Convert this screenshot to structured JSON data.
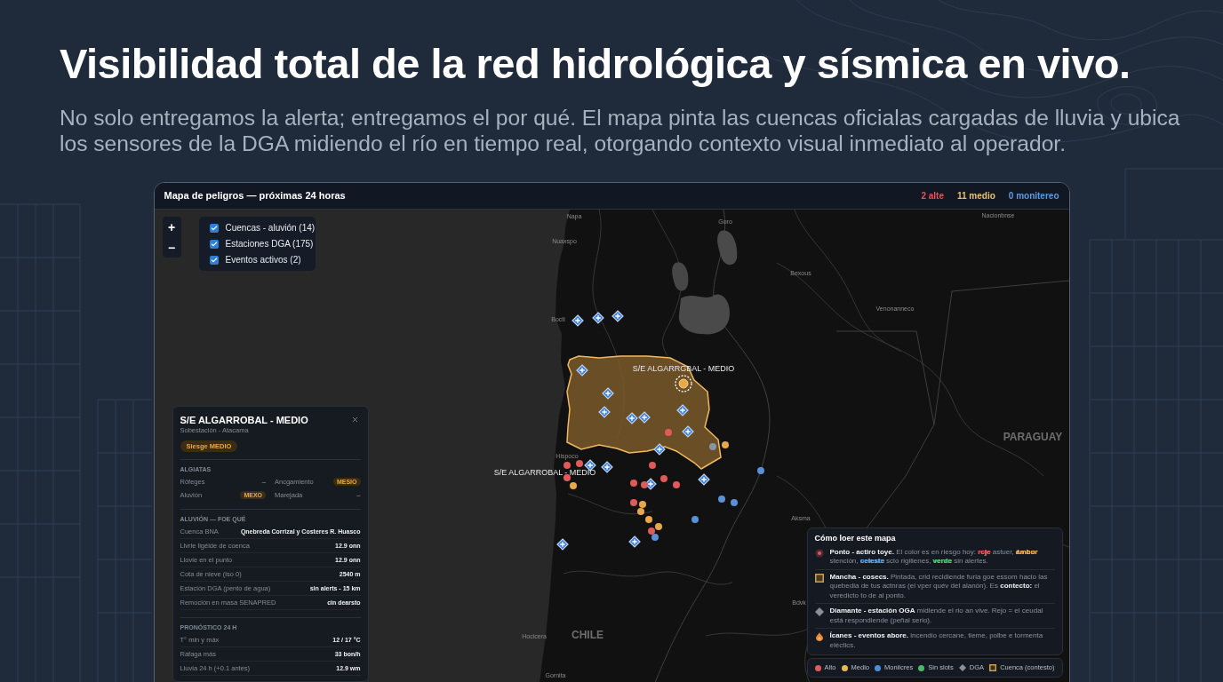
{
  "headline": "Visibilidad total de la red hidrológica y sísmica en vivo.",
  "intro": "No solo entregamos la alerta; entregamos el por qué. El mapa pinta las cuencas oficialas cargadas de lluvia y ubica los sensores de la DGA midiendo el río en tiempo real, otorgando contexto visual inmediato al operador.",
  "map_card": {
    "title": "Mapa de peligros — próximas 24 horas",
    "counts": [
      {
        "text": "2 alte",
        "color": "#e5535b"
      },
      {
        "text": "11 medio",
        "color": "#e8c070"
      },
      {
        "text": "0 monitereo",
        "color": "#5b9be0"
      }
    ],
    "zoom_buttons": [
      "+",
      "−"
    ],
    "layers": [
      {
        "label": "Cuencas - aluvión (14)",
        "checked": true
      },
      {
        "label": "Estaciones DGA (175)",
        "checked": true
      },
      {
        "label": "Eventos activos (2)",
        "checked": true
      }
    ],
    "places": [
      {
        "name": "Napa",
        "kind": "town"
      },
      {
        "name": "Nuaxspo",
        "kind": "town"
      },
      {
        "name": "Goro",
        "kind": "town"
      },
      {
        "name": "Bexous",
        "kind": "town"
      },
      {
        "name": "Nacionbnse",
        "kind": "town"
      },
      {
        "name": "Venonanneco",
        "kind": "town"
      },
      {
        "name": "Bocti",
        "kind": "town"
      },
      {
        "name": "S/E ALGARRGBAL - MEDIO",
        "kind": "marker"
      },
      {
        "name": "Hispoco",
        "kind": "town"
      },
      {
        "name": "S/E ALGARROBAL - MEDIO",
        "kind": "marker"
      },
      {
        "name": "PARAGUAY",
        "kind": "country"
      },
      {
        "name": "Aksma",
        "kind": "town"
      },
      {
        "name": "Bdvk",
        "kind": "town"
      },
      {
        "name": "Hocicera",
        "kind": "town"
      },
      {
        "name": "CHILE",
        "kind": "country"
      },
      {
        "name": "Gornita",
        "kind": "town"
      }
    ],
    "markers": [
      {
        "kind": "station",
        "selected": false
      },
      {
        "kind": "station",
        "selected": false
      },
      {
        "kind": "station",
        "selected": false
      },
      {
        "kind": "station",
        "selected": false
      },
      {
        "kind": "station",
        "selected": false
      },
      {
        "kind": "station",
        "selected": false
      },
      {
        "kind": "station",
        "selected": false
      },
      {
        "kind": "station",
        "selected": false
      },
      {
        "kind": "station",
        "selected": false
      },
      {
        "kind": "station",
        "selected": false
      },
      {
        "kind": "station",
        "selected": false
      },
      {
        "kind": "station",
        "selected": false
      },
      {
        "kind": "station",
        "selected": false
      },
      {
        "kind": "station",
        "selected": false
      },
      {
        "kind": "station",
        "selected": false
      },
      {
        "kind": "station",
        "selected": false
      },
      {
        "kind": "station",
        "selected": false
      },
      {
        "kind": "point",
        "color": "#e05a5a",
        "selected": false
      },
      {
        "kind": "point",
        "color": "#e05a5a",
        "selected": false
      },
      {
        "kind": "point",
        "color": "#e05a5a",
        "selected": false
      },
      {
        "kind": "point",
        "color": "#e05a5a",
        "selected": false
      },
      {
        "kind": "point",
        "color": "#e05a5a",
        "selected": false
      },
      {
        "kind": "point",
        "color": "#e05a5a",
        "selected": false
      },
      {
        "kind": "point",
        "color": "#e05a5a",
        "selected": false
      },
      {
        "kind": "point",
        "color": "#e05a5a",
        "selected": false
      },
      {
        "kind": "point",
        "color": "#e05a5a",
        "selected": false
      },
      {
        "kind": "point",
        "color": "#e05a5a",
        "selected": false
      },
      {
        "kind": "point",
        "color": "#e05a5a",
        "selected": false
      },
      {
        "kind": "point",
        "color": "#e8a84a",
        "selected": false
      },
      {
        "kind": "point",
        "color": "#e8a84a",
        "selected": false
      },
      {
        "kind": "point",
        "color": "#e8a84a",
        "selected": false
      },
      {
        "kind": "point",
        "color": "#e8a84a",
        "selected": false
      },
      {
        "kind": "point",
        "color": "#e8a84a",
        "selected": false
      },
      {
        "kind": "point",
        "color": "#e8a84a",
        "selected": false
      },
      {
        "kind": "point",
        "color": "#e8a84a",
        "selected": true
      },
      {
        "kind": "point",
        "color": "#5b8fd6",
        "selected": false
      },
      {
        "kind": "point",
        "color": "#5b8fd6",
        "selected": false
      },
      {
        "kind": "point",
        "color": "#5b8fd6",
        "selected": false
      },
      {
        "kind": "point",
        "color": "#5b8fd6",
        "selected": false
      },
      {
        "kind": "point",
        "color": "#5b8fd6",
        "selected": false
      },
      {
        "kind": "point",
        "color": "#8795a8",
        "selected": false
      }
    ],
    "popup": {
      "title": "S/E ALGARROBAL - MEDIO",
      "subtitle": "Sobestación - Atacama",
      "badge": "Siesge MEDIO",
      "sections": [
        {
          "heading": "ALGIATAS",
          "kind": "grid",
          "items": [
            {
              "label": "Rôfeges",
              "value": "–",
              "kind": "text"
            },
            {
              "label": "Ancgamiento",
              "value": "MESIO",
              "kind": "badge"
            },
            {
              "label": "Aluvión",
              "value": "MEXO",
              "kind": "badge"
            },
            {
              "label": "Marejada",
              "value": "–",
              "kind": "text"
            }
          ]
        },
        {
          "heading": "ALUVIÓN — FOE QUÉ",
          "kind": "rows",
          "items": [
            {
              "label": "Cuenca BNA",
              "value": "Qnebreda Corrizal y Costeres R. Huasco"
            },
            {
              "label": "Llvrie ligéide de coenca",
              "value": "12.9 onn"
            },
            {
              "label": "Llovie en el punto",
              "value": "12.9 onn"
            },
            {
              "label": "Cota de nieve (iso 0)",
              "value": "2540 m"
            },
            {
              "label": "Estación DGA (pento de agua)",
              "value": "sin alerts - 15 km"
            },
            {
              "label": "Remoción en masa SENAPRED",
              "value": "cin dearsto"
            }
          ]
        },
        {
          "heading": "PRONÓSTICO 24 H",
          "kind": "rows",
          "items": [
            {
              "label": "T° min y máx",
              "value": "12 / 17 °C"
            },
            {
              "label": "Ráfaga más",
              "value": "33 bon/h"
            },
            {
              "label": "Lluvia 24 h (+0.1 antes)",
              "value": "12.9 wm"
            }
          ]
        }
      ]
    },
    "legend": {
      "title": "Cómo loer este mapa",
      "items": [
        {
          "kind": "point",
          "parts": [
            {
              "text": "Ponto - actiro toye.",
              "bold": true
            },
            {
              "text": " El color es en riesgo hoy: ",
              "bold": false
            },
            {
              "text": "rcje",
              "bold": true,
              "color": "#e5535b"
            },
            {
              "text": " astuer, ",
              "bold": false
            },
            {
              "text": "ámbor",
              "bold": true,
              "color": "#e8a84a"
            },
            {
              "text": " stención, ",
              "bold": false
            },
            {
              "text": "celeste",
              "bold": true,
              "color": "#5b9be0"
            },
            {
              "text": " sclo rigilienes, ",
              "bold": false
            },
            {
              "text": "verde",
              "bold": true,
              "color": "#4cc06a"
            },
            {
              "text": " sin alertes.",
              "bold": false
            }
          ]
        },
        {
          "kind": "basin",
          "parts": [
            {
              "text": "Mancha - cosecs.",
              "bold": true
            },
            {
              "text": " Pintada, crid recidiende furia goe essom hacio las quebedia de tus actnras (el vper quév del alanón). Es ",
              "bold": false
            },
            {
              "text": "contecto:",
              "bold": true
            },
            {
              "text": " el veredicto to de al ponto.",
              "bold": false
            }
          ]
        },
        {
          "kind": "station",
          "parts": [
            {
              "text": "Diamante - estación OGA",
              "bold": true
            },
            {
              "text": " midiende el rio an vive. Rejo = el ceudal está respondiende (peñal serio).",
              "bold": false
            }
          ]
        },
        {
          "kind": "event",
          "parts": [
            {
              "text": "Ícanes - eventos abore.",
              "bold": true
            },
            {
              "text": " incendio cercane, tieme, polbe e tormenta eléctics.",
              "bold": false
            }
          ]
        }
      ],
      "key": [
        {
          "label": "Alto",
          "kind": "dot",
          "color": "#e05a5a"
        },
        {
          "label": "Medio",
          "kind": "dot",
          "color": "#e8b84a"
        },
        {
          "label": "Moniicres",
          "kind": "dot",
          "color": "#4b8fd6"
        },
        {
          "label": "Sin slots",
          "kind": "dot",
          "color": "#4cb86a"
        },
        {
          "label": "DGA",
          "kind": "diamond",
          "color": "#8a8f98"
        },
        {
          "label": "Cuenca (contesto)",
          "kind": "square",
          "color": "#c9a050"
        }
      ]
    }
  }
}
